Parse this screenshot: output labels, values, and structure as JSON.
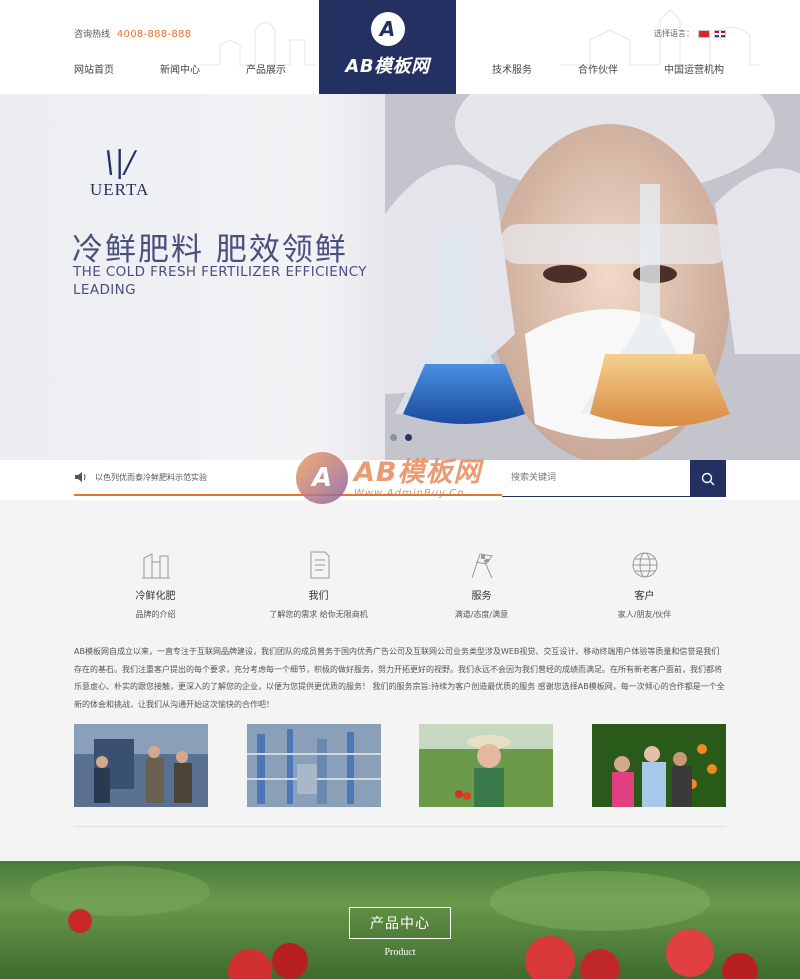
{
  "header": {
    "hotline_label": "咨询热线",
    "hotline_number": "4008-888-888",
    "language_label": "选择语言：",
    "logo_letter": "A",
    "logo_text": "AB模板网",
    "nav_left": [
      "网站首页",
      "新闻中心",
      "产品展示"
    ],
    "nav_right": [
      "技术服务",
      "合作伙伴",
      "中国运营机构"
    ]
  },
  "banner": {
    "brand_name": "UERTA",
    "title": "冷鲜肥料  肥效领鲜",
    "subtitle": "THE COLD FRESH FERTILIZER EFFICIENCY LEADING",
    "slides": 2,
    "active_slide": 2
  },
  "notice": {
    "text": "以色列优而泰冷鲜肥料示范实验"
  },
  "search": {
    "placeholder": "搜索关键词"
  },
  "watermark": {
    "title": "AB模板网",
    "url": "Www.AdminBuy.Cn"
  },
  "features": [
    {
      "title": "冷鲜化肥",
      "subtitle": "品牌的介绍",
      "icon": "buildings-icon"
    },
    {
      "title": "我们",
      "subtitle": "了解您的需求 给你无限商机",
      "icon": "document-icon"
    },
    {
      "title": "服务",
      "subtitle": "满道/态度/满意",
      "icon": "flags-icon"
    },
    {
      "title": "客户",
      "subtitle": "家人/朋友/伙伴",
      "icon": "globe-icon"
    }
  ],
  "about": "AB模板网自成立以来，一直专注于互联网品牌建设，我们团队的成员曾务于国内优秀广告公司及互联网公司业务类型涉及WEB视觉、交互设计、移动终端用户体验等质量和信誉是我们存在的基石。我们注重客户提出的每个要求，充分考虑每一个细节，积极的做好服务，努力开拓更好的视野。我们永远不会因为我们曾经的成绩而满足。在所有新老客户面前，我们都将乐意虚心、朴实的跟您接触，更深入的了解您的企业，以便为您提供更优质的服务！ 我们的服务宗旨:持续为客户创造最优质的服务 感谢您选择AB模板网，每一次倾心的合作都是一个全新的体会和挑战，让我们从沟通开始这次愉快的合作吧！",
  "gallery": [
    {
      "alt": "workers-photo"
    },
    {
      "alt": "factory-photo"
    },
    {
      "alt": "farmer-photo"
    },
    {
      "alt": "orchard-photo"
    }
  ],
  "product_section": {
    "title": "产品中心",
    "subtitle": "Product"
  },
  "colors": {
    "brand_navy": "#233061",
    "accent_orange": "#e8732a"
  }
}
